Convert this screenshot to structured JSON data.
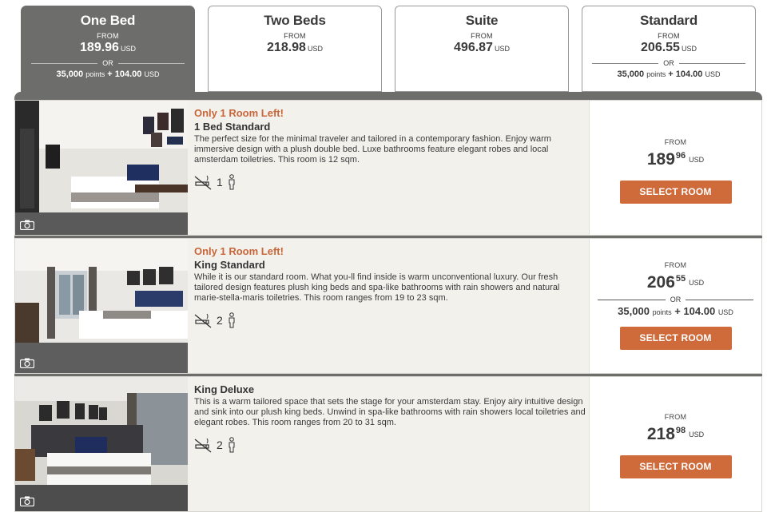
{
  "tabs": [
    {
      "name": "One Bed",
      "from": "FROM",
      "price": "189.96",
      "currency": "USD",
      "or": "OR",
      "points": "35,000",
      "points_label": "points",
      "plus": "+ 104.00",
      "active": true
    },
    {
      "name": "Two Beds",
      "from": "FROM",
      "price": "218.98",
      "currency": "USD"
    },
    {
      "name": "Suite",
      "from": "FROM",
      "price": "496.87",
      "currency": "USD"
    },
    {
      "name": "Standard",
      "from": "FROM",
      "price": "206.55",
      "currency": "USD",
      "or": "OR",
      "points": "35,000",
      "points_label": "points",
      "plus": "+ 104.00",
      "points_currency": "USD"
    }
  ],
  "rooms": [
    {
      "availability": "Only 1 Room Left!",
      "name": "1 Bed Standard",
      "description": "The perfect size for the minimal traveler and tailored in a contemporary fashion. Enjoy warm immersive design with a plush double bed. Luxe bathrooms feature elegant robes and local amsterdam toiletries. This room is 12 sqm.",
      "occupancy": "1",
      "from": "FROM",
      "price_whole": "189",
      "price_cents": "96",
      "currency": "USD",
      "button": "SELECT ROOM"
    },
    {
      "availability": "Only 1 Room Left!",
      "name": "King Standard",
      "description": "While it is our standard room. What you-ll find inside is warm unconventional luxury. Our fresh tailored design features plush king beds and spa-like bathrooms with rain showers and natural marie-stella-maris toiletries. This room ranges from 19 to 23 sqm.",
      "occupancy": "2",
      "from": "FROM",
      "price_whole": "206",
      "price_cents": "55",
      "currency": "USD",
      "or": "OR",
      "points": "35,000",
      "points_label": "points",
      "plus": "+ 104.00",
      "points_currency": "USD",
      "button": "SELECT ROOM"
    },
    {
      "availability": "",
      "name": "King Deluxe",
      "description": "This is a warm tailored space that sets the stage for your amsterdam stay. Enjoy airy intuitive design and sink into our plush king beds. Unwind in spa-like bathrooms with rain showers local toiletries and elegant robes. This room ranges from 20 to 31 sqm.",
      "occupancy": "2",
      "from": "FROM",
      "price_whole": "218",
      "price_cents": "98",
      "currency": "USD",
      "button": "SELECT ROOM"
    }
  ],
  "icons": {
    "camera": "camera-icon",
    "no_smoking": "no-smoking-icon",
    "person": "person-icon"
  },
  "colors": {
    "accent": "#cf6b3a",
    "active_tab": "#6d6d6b",
    "availability": "#c8663a",
    "row_bg": "#f2f1ec"
  }
}
